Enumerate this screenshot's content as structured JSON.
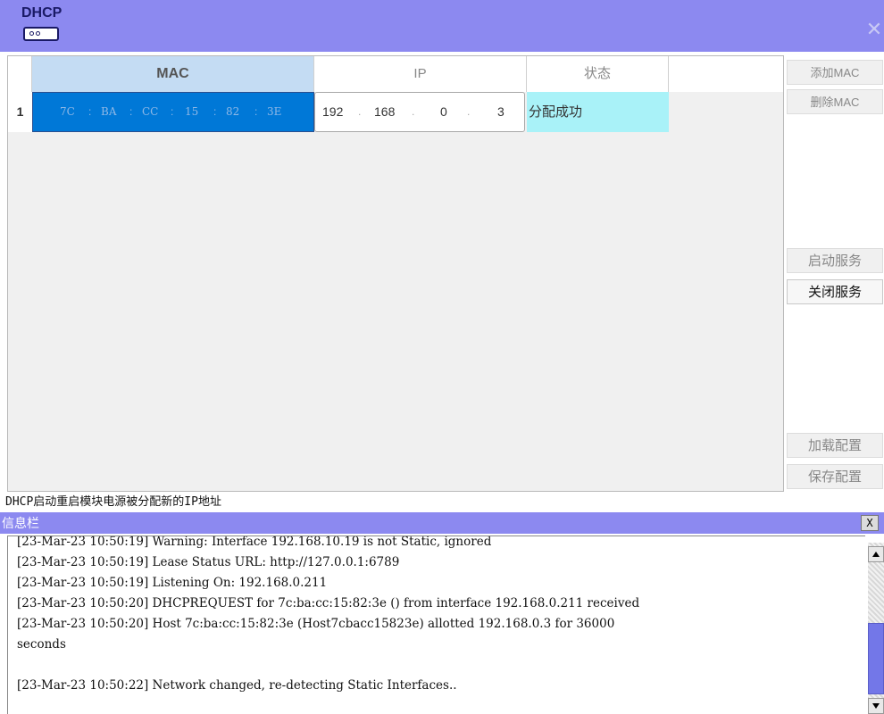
{
  "window": {
    "logo_text": "DHCP",
    "close_icon": "close-x-icon"
  },
  "table": {
    "headers": {
      "mac": "MAC",
      "ip": "IP",
      "status": "状态"
    },
    "rows": [
      {
        "index": "1",
        "mac": [
          "7C",
          "BA",
          "CC",
          "15",
          "82",
          "3E"
        ],
        "ip": [
          "192",
          "168",
          "0",
          "3"
        ],
        "status": "分配成功"
      }
    ]
  },
  "buttons": {
    "add_mac": "添加MAC",
    "delete_mac": "删除MAC",
    "start_service": "启动服务",
    "stop_service": "关闭服务",
    "load_config": "加载配置",
    "save_config": "保存配置"
  },
  "status_message": "DHCP启动重启模块电源被分配新的IP地址",
  "info_panel": {
    "title": "信息栏",
    "close_label": "X",
    "log_lines": [
      "[23-Mar-23 10:50:19] Warning: Interface 192.168.10.19 is not Static, ignored",
      "[23-Mar-23 10:50:19] Lease Status URL: http://127.0.0.1:6789",
      "[23-Mar-23 10:50:19] Listening On: 192.168.0.211",
      "[23-Mar-23 10:50:20] DHCPREQUEST for 7c:ba:cc:15:82:3e () from interface 192.168.0.211 received",
      "[23-Mar-23 10:50:20] Host 7c:ba:cc:15:82:3e (Host7cbacc15823e) allotted 192.168.0.3 for 36000",
      "seconds",
      "",
      "[23-Mar-23 10:50:22] Network changed, re-detecting Static Interfaces.."
    ]
  },
  "colors": {
    "title_bar": "#8c89f0",
    "mac_header": "#c4dcf3",
    "mac_selected": "#0078d7",
    "status_cell": "#a9f2f8",
    "scroll_thumb": "#7377e8"
  }
}
